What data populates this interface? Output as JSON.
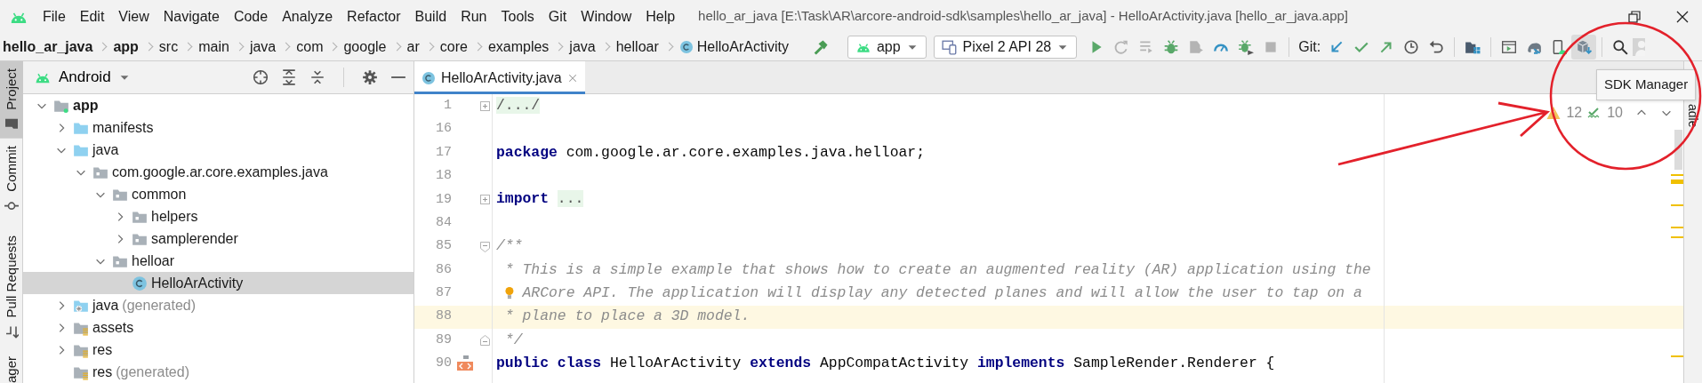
{
  "menu_bar": {
    "items": [
      {
        "text": "File"
      },
      {
        "text": "Edit"
      },
      {
        "text": "View"
      },
      {
        "text": "Navigate"
      },
      {
        "text": "Code"
      },
      {
        "text": "Analyze"
      },
      {
        "text": "Refactor"
      },
      {
        "text": "Build"
      },
      {
        "text": "Run"
      },
      {
        "text": "Tools"
      },
      {
        "text": "Git"
      },
      {
        "text": "Window"
      },
      {
        "text": "Help"
      }
    ],
    "window_title": "hello_ar_java [E:\\Task\\AR\\arcore-android-sdk\\samples\\hello_ar_java] - HelloArActivity.java [hello_ar_java.app]"
  },
  "breadcrumbs": [
    {
      "label": "hello_ar_java",
      "kind": "project"
    },
    {
      "label": "app",
      "kind": "module"
    },
    {
      "label": "src",
      "kind": "dir"
    },
    {
      "label": "main",
      "kind": "dir"
    },
    {
      "label": "java",
      "kind": "dir"
    },
    {
      "label": "com",
      "kind": "dir"
    },
    {
      "label": "google",
      "kind": "dir"
    },
    {
      "label": "ar",
      "kind": "dir"
    },
    {
      "label": "core",
      "kind": "dir"
    },
    {
      "label": "examples",
      "kind": "dir"
    },
    {
      "label": "java",
      "kind": "dir"
    },
    {
      "label": "helloar",
      "kind": "dir"
    },
    {
      "label": "HelloArActivity",
      "kind": "class"
    }
  ],
  "toolbar": {
    "run_configuration": "app",
    "device": "Pixel 2 API 28",
    "run_buttons": [
      {
        "kind": "run",
        "disabled": false
      },
      {
        "kind": "rerun",
        "disabled": true
      },
      {
        "kind": "apply_changes",
        "disabled": true
      },
      {
        "kind": "debug",
        "disabled": false
      },
      {
        "kind": "attach",
        "disabled": true
      },
      {
        "kind": "profile",
        "disabled": false
      },
      {
        "kind": "attach_debugger",
        "disabled": false
      },
      {
        "kind": "stop",
        "disabled": true
      }
    ],
    "git_label": "Git:",
    "git_buttons": [
      {
        "kind": "update"
      },
      {
        "kind": "commit"
      },
      {
        "kind": "push"
      },
      {
        "kind": "history"
      },
      {
        "kind": "rollback"
      }
    ],
    "tool_buttons": [
      {
        "kind": "project_structure",
        "hovered": false
      },
      {
        "kind": "preview",
        "hovered": false
      },
      {
        "kind": "gradle_sync",
        "hovered": false
      },
      {
        "kind": "device_manager",
        "hovered": false
      },
      {
        "kind": "sdk_manager",
        "hovered": true
      }
    ]
  },
  "left_tool_bar": [
    {
      "label": "Project",
      "kind": "project",
      "selected": true
    },
    {
      "label": "Commit",
      "kind": "commit",
      "selected": false
    },
    {
      "label": "Pull Requests",
      "kind": "pull_requests",
      "selected": false
    },
    {
      "label": "ager",
      "kind": "resource_manager",
      "selected": false
    }
  ],
  "right_tool_bar": [
    {
      "label": "adle"
    }
  ],
  "project_panel": {
    "view": "Android",
    "tree": [
      {
        "label": "app",
        "kind": "module",
        "expanded": true,
        "selected": false,
        "children": [
          {
            "label": "manifests",
            "kind": "folder",
            "expanded": false,
            "selected": false
          },
          {
            "label": "java",
            "kind": "folder",
            "expanded": true,
            "selected": false,
            "children": [
              {
                "label": "com.google.ar.core.examples.java",
                "kind": "package",
                "expanded": true,
                "selected": false,
                "children": [
                  {
                    "label": "common",
                    "kind": "package",
                    "expanded": true,
                    "selected": false,
                    "children": [
                      {
                        "label": "helpers",
                        "kind": "package",
                        "expanded": false,
                        "selected": false
                      },
                      {
                        "label": "samplerender",
                        "kind": "package",
                        "expanded": false,
                        "selected": false
                      }
                    ]
                  },
                  {
                    "label": "helloar",
                    "kind": "package",
                    "expanded": true,
                    "selected": false,
                    "children": [
                      {
                        "label": "HelloArActivity",
                        "kind": "class",
                        "selected": true
                      }
                    ]
                  }
                ]
              }
            ]
          },
          {
            "label": "java",
            "secondary": "(generated)",
            "kind": "generated_folder",
            "expanded": false,
            "selected": false
          },
          {
            "label": "assets",
            "kind": "resource_folder",
            "expanded": false,
            "selected": false
          },
          {
            "label": "res",
            "kind": "resource_folder",
            "expanded": false,
            "selected": false
          },
          {
            "label": "res",
            "secondary": "(generated)",
            "kind": "resource_folder",
            "selected": false
          }
        ]
      }
    ]
  },
  "editor": {
    "tabs": [
      {
        "label": "HelloArActivity.java",
        "selected": true
      }
    ],
    "inspections": {
      "warnings": "12",
      "weak_warnings": "10"
    },
    "lines": [
      {
        "number": "1",
        "collapsed": true,
        "fold_start": false,
        "fold_end": false,
        "bulb": false,
        "implements_marker": false,
        "current": false,
        "tokens": [
          {
            "kind": "folded",
            "text": "/.../"
          }
        ]
      },
      {
        "number": "16",
        "collapsed": false,
        "fold_start": false,
        "fold_end": false,
        "bulb": false,
        "implements_marker": false,
        "current": false
      },
      {
        "number": "17",
        "collapsed": false,
        "fold_start": false,
        "fold_end": false,
        "bulb": false,
        "implements_marker": false,
        "current": false,
        "tokens": [
          {
            "kind": "keyword",
            "text": "package"
          },
          {
            "kind": "plain",
            "text": " com.google.ar.core.examples.java.helloar;"
          }
        ]
      },
      {
        "number": "18",
        "collapsed": false,
        "fold_start": false,
        "fold_end": false,
        "bulb": false,
        "implements_marker": false,
        "current": false
      },
      {
        "number": "19",
        "collapsed": true,
        "fold_start": false,
        "fold_end": false,
        "bulb": false,
        "implements_marker": false,
        "current": false,
        "tokens": [
          {
            "kind": "keyword",
            "text": "import "
          },
          {
            "kind": "folded",
            "text": "..."
          }
        ]
      },
      {
        "number": "84",
        "collapsed": false,
        "fold_start": false,
        "fold_end": false,
        "bulb": false,
        "implements_marker": false,
        "current": false
      },
      {
        "number": "85",
        "collapsed": false,
        "fold_start": true,
        "fold_end": false,
        "bulb": false,
        "implements_marker": false,
        "current": false,
        "tokens": [
          {
            "kind": "comment",
            "text": "/**"
          }
        ]
      },
      {
        "number": "86",
        "collapsed": false,
        "fold_start": false,
        "fold_end": false,
        "bulb": false,
        "implements_marker": false,
        "current": false,
        "tokens": [
          {
            "kind": "comment",
            "text": " * This is a simple example that shows how to create an augmented reality (AR) application using the"
          }
        ]
      },
      {
        "number": "87",
        "collapsed": false,
        "fold_start": false,
        "fold_end": false,
        "bulb": true,
        "implements_marker": false,
        "current": false,
        "tokens": [
          {
            "kind": "comment",
            "text": "ARCore API. The application will display any detected planes and will allow the user to tap on a"
          }
        ]
      },
      {
        "number": "88",
        "collapsed": false,
        "fold_start": false,
        "fold_end": false,
        "bulb": false,
        "implements_marker": false,
        "current": true,
        "tokens": [
          {
            "kind": "comment",
            "text": " * plane to place a 3D model."
          }
        ]
      },
      {
        "number": "89",
        "collapsed": false,
        "fold_start": false,
        "fold_end": true,
        "bulb": false,
        "implements_marker": false,
        "current": false,
        "tokens": [
          {
            "kind": "comment",
            "text": " */"
          }
        ]
      },
      {
        "number": "90",
        "collapsed": false,
        "fold_start": false,
        "fold_end": false,
        "bulb": false,
        "implements_marker": true,
        "current": false,
        "tokens": [
          {
            "kind": "keyword",
            "text": "public class"
          },
          {
            "kind": "plain",
            "text": " HelloArActivity "
          },
          {
            "kind": "keyword",
            "text": "extends"
          },
          {
            "kind": "plain",
            "text": " AppCompatActivity "
          },
          {
            "kind": "keyword",
            "text": "implements"
          },
          {
            "kind": "plain",
            "text": " SampleRender.Renderer {"
          }
        ]
      }
    ]
  },
  "tooltip": {
    "text": "SDK Manager"
  }
}
